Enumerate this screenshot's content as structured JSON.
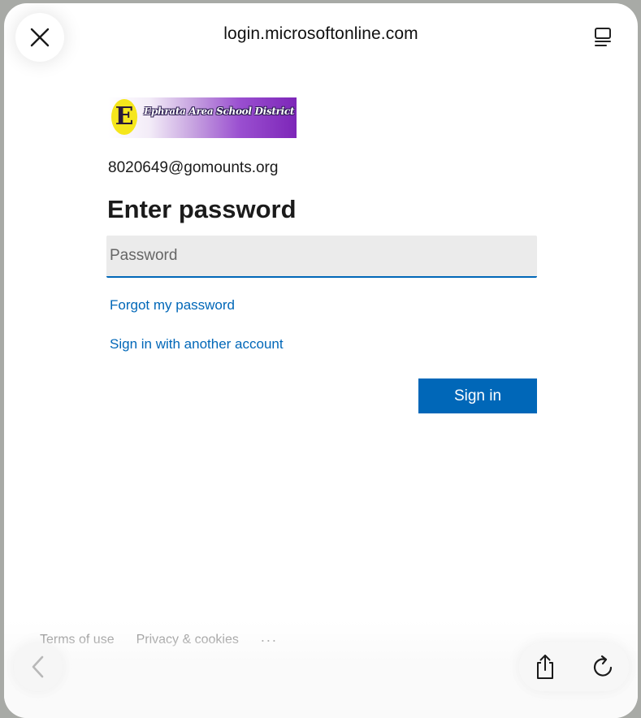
{
  "browser": {
    "url": "login.microsoftonline.com",
    "close_icon": "close-icon",
    "reader_icon": "reader-mode-icon",
    "back_icon": "chevron-left-icon",
    "share_icon": "share-icon",
    "reload_icon": "reload-icon"
  },
  "logo": {
    "letter": "E",
    "name": "Ephrata Area School District"
  },
  "login": {
    "email": "8020649@gomounts.org",
    "heading": "Enter password",
    "password_placeholder": "Password",
    "password_value": "",
    "forgot_link": "Forgot my password",
    "another_account_link": "Sign in with another account",
    "signin_button": "Sign in"
  },
  "footer": {
    "terms": "Terms of use",
    "privacy": "Privacy & cookies",
    "more": "..."
  },
  "colors": {
    "accent": "#0067b8",
    "field_bg": "#ebebeb",
    "text": "#1b1b1b",
    "footer_text": "#707070"
  }
}
